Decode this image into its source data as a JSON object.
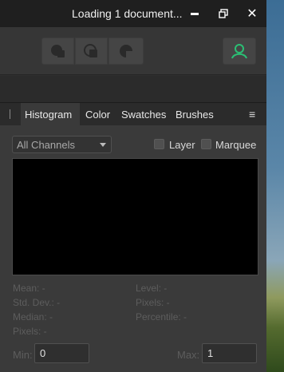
{
  "window": {
    "title": "Loading 1 document...",
    "close_glyph": "✕",
    "restore_glyph": "🗗"
  },
  "toolbar": {
    "buttons": [
      "boolean-add-icon",
      "boolean-subtract-icon",
      "boolean-intersect-icon"
    ],
    "user_icon": "user-icon"
  },
  "panel": {
    "tabs": [
      {
        "label": "Histogram",
        "active": true
      },
      {
        "label": "Color",
        "active": false
      },
      {
        "label": "Swatches",
        "active": false
      },
      {
        "label": "Brushes",
        "active": false
      }
    ],
    "menu_glyph": "≡"
  },
  "histogram": {
    "channel_select": "All Channels",
    "layer_label": "Layer",
    "marquee_label": "Marquee",
    "stats": {
      "mean": "Mean: -",
      "std_dev": "Std. Dev.: -",
      "median": "Median: -",
      "pixels": "Pixels: -",
      "level": "Level: -",
      "pixels_right": "Pixels: -",
      "percentile": "Percentile: -"
    },
    "min_label": "Min:",
    "min_value": "0",
    "max_label": "Max:",
    "max_value": "1"
  },
  "colors": {
    "accent_user": "#2bbf74"
  }
}
